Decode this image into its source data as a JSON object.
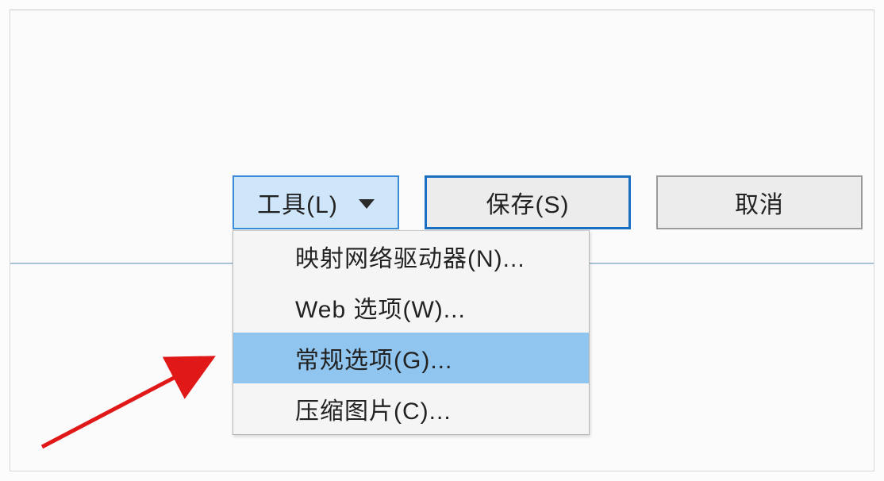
{
  "buttons": {
    "tools_label": "工具(L)",
    "save_label": "保存(S)",
    "cancel_label": "取消"
  },
  "dropdown": {
    "items": [
      {
        "label": "映射网络驱动器(N)...",
        "highlighted": false
      },
      {
        "label": "Web 选项(W)...",
        "highlighted": false
      },
      {
        "label": "常规选项(G)...",
        "highlighted": true
      },
      {
        "label": "压缩图片(C)...",
        "highlighted": false
      }
    ]
  },
  "annotation": {
    "arrow_color": "#e01818"
  }
}
